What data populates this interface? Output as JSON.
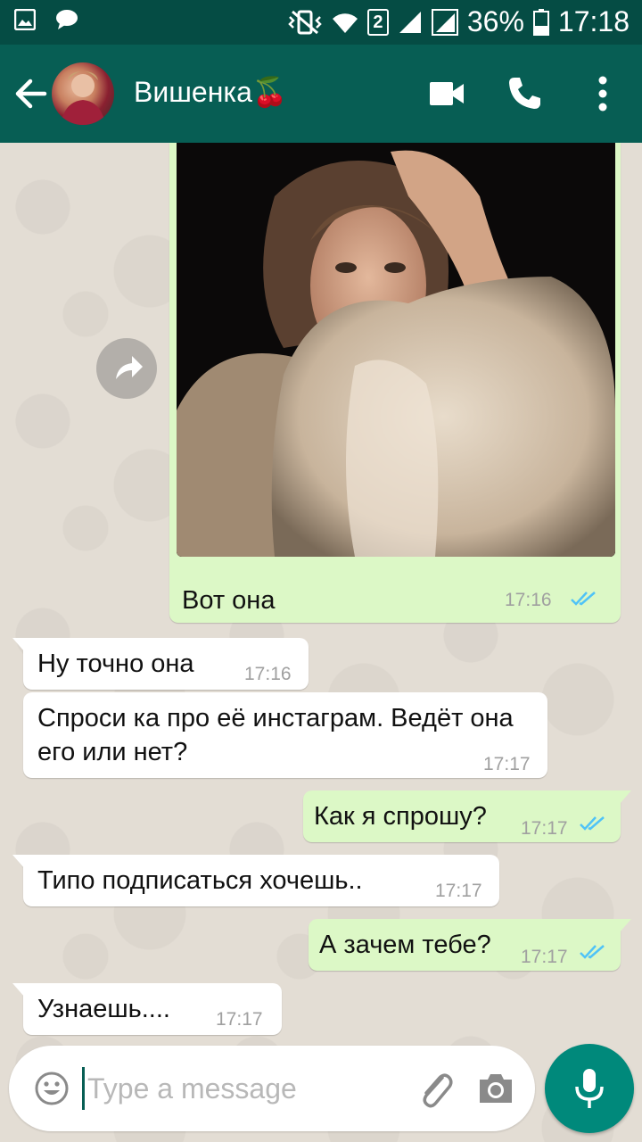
{
  "status_bar": {
    "battery": "36%",
    "time": "17:18",
    "sim": "2",
    "icons": [
      "gallery-icon",
      "chat-bubble-icon",
      "vibrate-icon",
      "wifi-icon",
      "signal-icon",
      "battery-icon"
    ]
  },
  "header": {
    "contact_name": "Вишенка🍒",
    "icons": [
      "back-arrow-icon",
      "video-call-icon",
      "phone-call-icon",
      "more-vert-icon"
    ]
  },
  "messages": [
    {
      "dir": "out",
      "type": "image",
      "text": "Вот она",
      "time": "17:16",
      "ticks": "read"
    },
    {
      "dir": "in",
      "text": "Ну точно она",
      "time": "17:16"
    },
    {
      "dir": "in",
      "text": "Спроси ка про её инстаграм. Ведёт она его или нет?",
      "time": "17:17"
    },
    {
      "dir": "out",
      "text": "Как я спрошу?",
      "time": "17:17",
      "ticks": "read"
    },
    {
      "dir": "in",
      "text": "Типо подписаться хочешь..",
      "time": "17:17"
    },
    {
      "dir": "out",
      "text": "А зачем тебе?",
      "time": "17:17",
      "ticks": "read"
    },
    {
      "dir": "in",
      "text": "Узнаешь....",
      "time": "17:17"
    }
  ],
  "composer": {
    "placeholder": "Type a message",
    "value": "",
    "icons": [
      "emoji-icon",
      "attach-icon",
      "camera-icon",
      "mic-icon"
    ]
  },
  "colors": {
    "header": "#075e54",
    "status_bar": "#054c44",
    "out_bubble": "#dcf8c6",
    "in_bubble": "#ffffff",
    "read_ticks": "#4fc3f7",
    "fab": "#00897b"
  }
}
